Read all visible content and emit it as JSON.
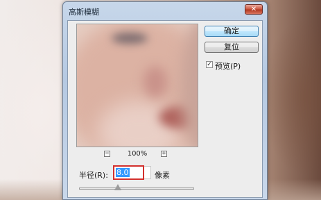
{
  "dialog": {
    "title": "高斯模糊",
    "close_symbol": "✕"
  },
  "preview": {
    "zoom_out_symbol": "−",
    "zoom_in_symbol": "+",
    "zoom_level": "100%"
  },
  "buttons": {
    "ok_label": "确定",
    "reset_label": "复位"
  },
  "preview_checkbox": {
    "label": "预览(P)",
    "checked": true,
    "check_symbol": "✓"
  },
  "radius": {
    "label": "半径(R):",
    "value": "8.0",
    "unit": "像素",
    "slider_fraction": 0.34
  },
  "colors": {
    "accent_border": "#d3302c",
    "selection": "#3399ff",
    "default_button": "#bee6fd"
  }
}
